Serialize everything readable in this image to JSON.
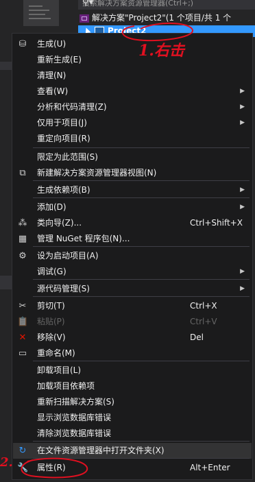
{
  "solution_explorer": {
    "search_placeholder": "搜索解决方案资源管理器(Ctrl+;)",
    "solution_label": "解决方案\"Project2\"(1 个项目/共 1 个",
    "project_label": "Project2"
  },
  "context_menu": {
    "items": [
      {
        "label": "生成(U)",
        "shortcut": "",
        "icon": "build-icon",
        "submenu": false,
        "disabled": false
      },
      {
        "label": "重新生成(E)",
        "shortcut": "",
        "icon": "",
        "submenu": false,
        "disabled": false
      },
      {
        "label": "清理(N)",
        "shortcut": "",
        "icon": "",
        "submenu": false,
        "disabled": false
      },
      {
        "label": "查看(W)",
        "shortcut": "",
        "icon": "",
        "submenu": true,
        "disabled": false
      },
      {
        "label": "分析和代码清理(Z)",
        "shortcut": "",
        "icon": "",
        "submenu": true,
        "disabled": false
      },
      {
        "label": "仅用于项目(J)",
        "shortcut": "",
        "icon": "",
        "submenu": true,
        "disabled": false
      },
      {
        "label": "重定向项目(R)",
        "shortcut": "",
        "icon": "",
        "submenu": false,
        "disabled": false
      },
      {
        "label": "限定为此范围(S)",
        "shortcut": "",
        "icon": "",
        "submenu": false,
        "disabled": false
      },
      {
        "label": "新建解决方案资源管理器视图(N)",
        "shortcut": "",
        "icon": "new-view-icon",
        "submenu": false,
        "disabled": false
      },
      {
        "label": "生成依赖项(B)",
        "shortcut": "",
        "icon": "",
        "submenu": true,
        "disabled": false
      },
      {
        "label": "添加(D)",
        "shortcut": "",
        "icon": "",
        "submenu": true,
        "disabled": false
      },
      {
        "label": "类向导(Z)...",
        "shortcut": "Ctrl+Shift+X",
        "icon": "class-wizard-icon",
        "submenu": false,
        "disabled": false
      },
      {
        "label": "管理 NuGet 程序包(N)...",
        "shortcut": "",
        "icon": "nuget-icon",
        "submenu": false,
        "disabled": false
      },
      {
        "label": "设为启动项目(A)",
        "shortcut": "",
        "icon": "gear-icon",
        "submenu": false,
        "disabled": false
      },
      {
        "label": "调试(G)",
        "shortcut": "",
        "icon": "",
        "submenu": true,
        "disabled": false
      },
      {
        "label": "源代码管理(S)",
        "shortcut": "",
        "icon": "",
        "submenu": true,
        "disabled": false
      },
      {
        "label": "剪切(T)",
        "shortcut": "Ctrl+X",
        "icon": "scissors-icon",
        "submenu": false,
        "disabled": false
      },
      {
        "label": "粘贴(P)",
        "shortcut": "Ctrl+V",
        "icon": "paste-icon",
        "submenu": false,
        "disabled": true
      },
      {
        "label": "移除(V)",
        "shortcut": "Del",
        "icon": "remove-icon",
        "submenu": false,
        "disabled": false
      },
      {
        "label": "重命名(M)",
        "shortcut": "",
        "icon": "rename-icon",
        "submenu": false,
        "disabled": false
      },
      {
        "label": "卸载项目(L)",
        "shortcut": "",
        "icon": "",
        "submenu": false,
        "disabled": false
      },
      {
        "label": "加载项目依赖项",
        "shortcut": "",
        "icon": "",
        "submenu": false,
        "disabled": false
      },
      {
        "label": "重新扫描解决方案(S)",
        "shortcut": "",
        "icon": "",
        "submenu": false,
        "disabled": false
      },
      {
        "label": "显示浏览数据库错误",
        "shortcut": "",
        "icon": "",
        "submenu": false,
        "disabled": false
      },
      {
        "label": "清除浏览数据库错误",
        "shortcut": "",
        "icon": "",
        "submenu": false,
        "disabled": false
      },
      {
        "label": "在文件资源管理器中打开文件夹(X)",
        "shortcut": "",
        "icon": "open-folder-icon",
        "submenu": false,
        "disabled": false
      },
      {
        "label": "属性(R)",
        "shortcut": "Alt+Enter",
        "icon": "wrench-icon",
        "submenu": false,
        "disabled": false
      }
    ]
  },
  "annotations": {
    "step1": "1.右击",
    "step2": "2."
  },
  "colors": {
    "accent": "#3399ff",
    "annotation": "#e01020",
    "remove_icon": "#e51400"
  }
}
